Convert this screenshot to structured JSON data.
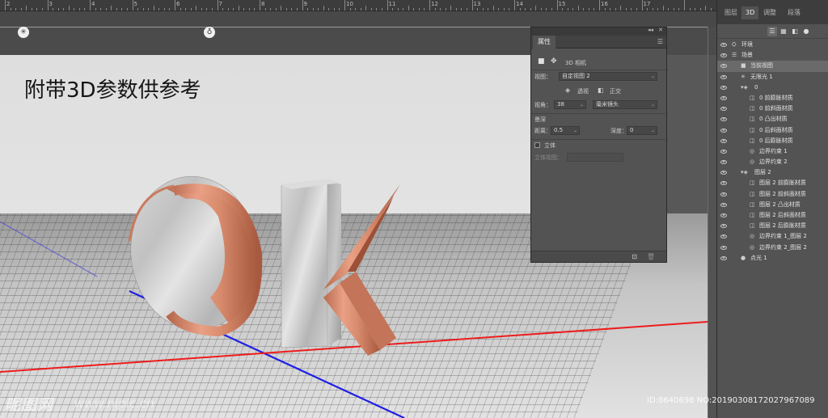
{
  "ruler": {
    "numbers": [
      "2",
      "3",
      "4",
      "5",
      "6",
      "7",
      "8",
      "9",
      "10",
      "11",
      "12",
      "13",
      "14",
      "15",
      "16",
      "17"
    ]
  },
  "canvas": {
    "headline": "附带3D参数供参考",
    "icons": [
      "light-icon",
      "point-light-icon"
    ]
  },
  "properties_panel": {
    "tab": "属性",
    "menu_icon": "menu-icon",
    "header_icons": [
      "camera-icon",
      "mesh-icon"
    ],
    "section_title": "3D 相机",
    "view_label": "视图：",
    "view_value": "自定视图 2",
    "perspective_label": "透视",
    "orthographic_label": "正交",
    "fov_label": "视角：",
    "fov_value": "38",
    "fov_unit": "毫米镜头",
    "dof_title": "景深",
    "distance_label": "距离：",
    "distance_value": "0.5",
    "depth_label": "深度：",
    "depth_value": "0",
    "stereo_label": "立体",
    "stereo_view_label": "立体视图："
  },
  "right_panel": {
    "tabs": [
      "图层",
      "3D",
      "调整",
      "段落"
    ],
    "active_tab": "3D",
    "tools": [
      "scene-filter-icon",
      "mesh-filter-icon",
      "material-filter-icon",
      "light-filter-icon"
    ],
    "items": [
      {
        "label": "环境",
        "icon": "⛭",
        "indent": 0
      },
      {
        "label": "场景",
        "icon": "☰",
        "indent": 0
      },
      {
        "label": "当前视图",
        "icon": "■",
        "indent": 1,
        "highlighted": true
      },
      {
        "label": "无限光 1",
        "icon": "✳",
        "indent": 1
      },
      {
        "label": "0",
        "icon": "▾◈",
        "indent": 1
      },
      {
        "label": "0 前膨胀材质",
        "icon": "◫",
        "indent": 2
      },
      {
        "label": "0 前斜面材质",
        "icon": "◫",
        "indent": 2
      },
      {
        "label": "0 凸出材质",
        "icon": "◫",
        "indent": 2
      },
      {
        "label": "0 后斜面材质",
        "icon": "◫",
        "indent": 2
      },
      {
        "label": "0 后膨胀材质",
        "icon": "◫",
        "indent": 2
      },
      {
        "label": "边界约束 1",
        "icon": "◎",
        "indent": 2
      },
      {
        "label": "边界约束 2",
        "icon": "◎",
        "indent": 2
      },
      {
        "label": "图层 2",
        "icon": "▾◈",
        "indent": 1
      },
      {
        "label": "图层 2 前膨胀材质",
        "icon": "◫",
        "indent": 2
      },
      {
        "label": "图层 2 前斜面材质",
        "icon": "◫",
        "indent": 2
      },
      {
        "label": "图层 2 凸出材质",
        "icon": "◫",
        "indent": 2
      },
      {
        "label": "图层 2 后斜面材质",
        "icon": "◫",
        "indent": 2
      },
      {
        "label": "图层 2 后膨胀材质",
        "icon": "◫",
        "indent": 2
      },
      {
        "label": "边界约束 1_图层 2",
        "icon": "◎",
        "indent": 2
      },
      {
        "label": "边界约束 2_图层 2",
        "icon": "◎",
        "indent": 2
      },
      {
        "label": "点光 1",
        "icon": "●",
        "indent": 1
      }
    ]
  },
  "watermark": {
    "brand": "昵图网",
    "url": "www.nipic.cn",
    "id_text": "ID:8640698 NO:20190308172027967089"
  }
}
